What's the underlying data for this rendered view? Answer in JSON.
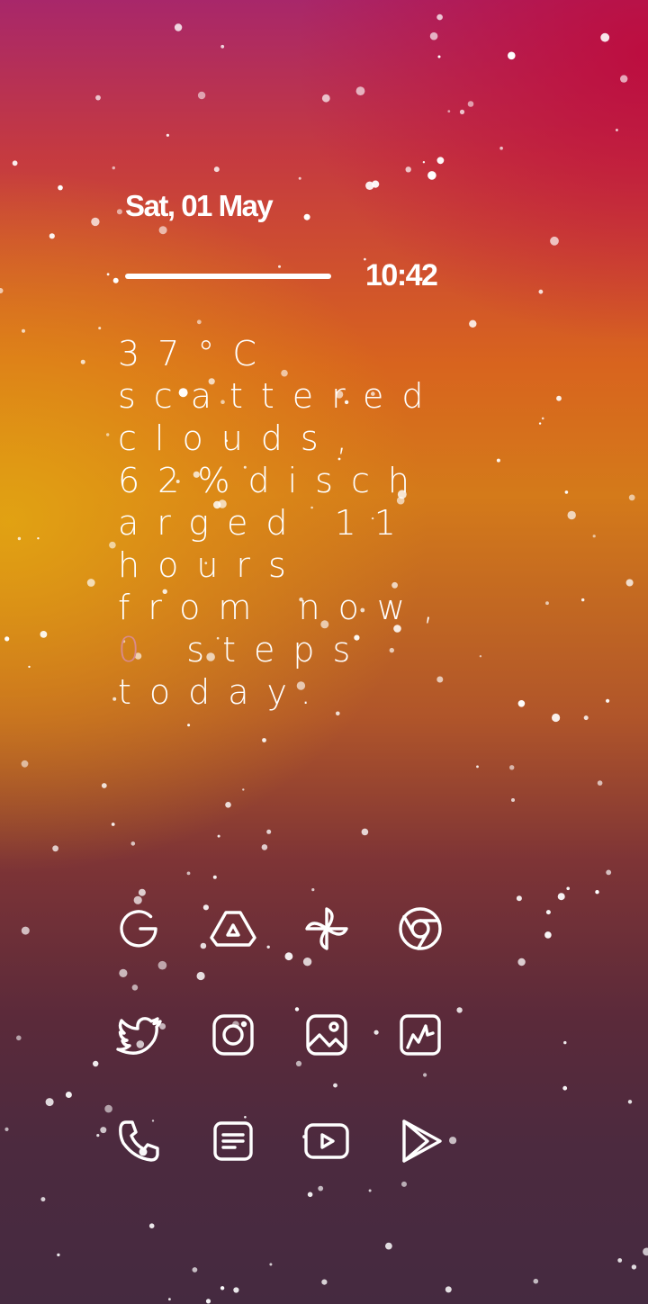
{
  "lockscreen": {
    "date": "Sat, 01 May",
    "time": "10:42",
    "weather_text": "37°C scattered clouds, 62%discharged 11 hours from now, ",
    "steps_count": "0",
    "steps_text": " steps today."
  },
  "colors": {
    "accent_text": "#ffffff",
    "steps_highlight": "#d98a8a"
  },
  "apps": [
    {
      "name": "Google",
      "icon": "google-icon"
    },
    {
      "name": "Drive",
      "icon": "drive-icon"
    },
    {
      "name": "Pinwheel",
      "icon": "pinwheel-icon"
    },
    {
      "name": "Chrome",
      "icon": "chrome-icon"
    },
    {
      "name": "Twitter",
      "icon": "twitter-icon"
    },
    {
      "name": "Instagram",
      "icon": "instagram-icon"
    },
    {
      "name": "Gallery",
      "icon": "gallery-icon"
    },
    {
      "name": "Wallpaper",
      "icon": "wallpaper-icon"
    },
    {
      "name": "Phone",
      "icon": "phone-icon"
    },
    {
      "name": "Notes",
      "icon": "notes-icon"
    },
    {
      "name": "YouTube",
      "icon": "youtube-icon"
    },
    {
      "name": "Play Store",
      "icon": "play-store-icon"
    }
  ]
}
